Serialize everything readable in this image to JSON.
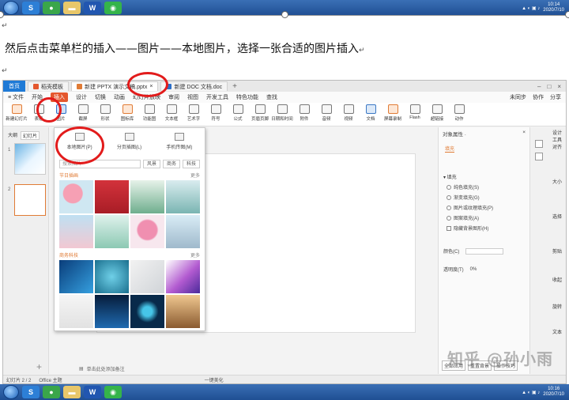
{
  "taskbar": {
    "time": "10:14",
    "date": "2020/7/10",
    "time_bottom": "10:16",
    "date_bottom": "2020/7/10",
    "apps": [
      "S",
      "W"
    ]
  },
  "document": {
    "instruction": "然后点击菜单栏的插入——图片——本地图片，选择一张合适的图片插入",
    "para_mark": "↵"
  },
  "wps": {
    "tabs": [
      {
        "label": "首页"
      },
      {
        "label": "稻壳模板"
      },
      {
        "label": "新建 PPTX 演示文稿.pptx"
      },
      {
        "label": "新建 DOC 文档.doc"
      }
    ],
    "menu": [
      "≡ 文件",
      "开始",
      "插入",
      "设计",
      "切换",
      "动画",
      "幻灯片放映",
      "审阅",
      "视图",
      "开发工具",
      "特色功能",
      "查找"
    ],
    "menu_right": [
      "未同步",
      "协作",
      "分享"
    ],
    "tools": [
      "新建幻灯片",
      "表格",
      "图片",
      "截屏",
      "形状",
      "图标库",
      "功能图",
      "文本框",
      "艺术字",
      "符号",
      "公式",
      "页眉页脚",
      "日期和时间",
      "附件",
      "音频",
      "视频",
      "文档",
      "屏幕录制",
      "Flash",
      "超链接",
      "动作"
    ],
    "left_panel": {
      "tab_outline": "大纲",
      "tab_slides": "幻灯片",
      "slide_nums": [
        "1",
        "2"
      ],
      "add": "+"
    },
    "picture_menu": {
      "options": [
        "本地图片(P)",
        "分页插图(L)",
        "手机传图(M)"
      ],
      "search_placeholder": "搜索图片",
      "chips": [
        "风景",
        "商务",
        "科技"
      ],
      "section1_title": "节日插画",
      "section2_title": "商务科技",
      "more": "更多"
    },
    "notes": "单击此处添加备注",
    "right_panel": {
      "title": "对象属性 ·",
      "tab": "填充",
      "section": "▾ 填充",
      "options": [
        "纯色填充(S)",
        "渐变填充(G)",
        "图片或纹理填充(P)",
        "图案填充(A)"
      ],
      "hide_bg": "隐藏背景图形(H)",
      "color_label": "颜色(C)",
      "transparency_label": "透明度(T)",
      "transparency_value": "0%",
      "buttons": [
        "全部应用",
        "重置背景",
        "操作技巧"
      ]
    },
    "sidebar": [
      "对齐",
      "大小",
      "选择",
      "剪贴",
      "收起",
      "旋转",
      "文本",
      "设计工具"
    ],
    "status": {
      "slide": "幻灯片 2 / 2",
      "theme": "Office 主题",
      "beautify": "一键美化"
    }
  },
  "watermark": "知乎 @孙小雨",
  "colors": {
    "annotation": "#e21b1b",
    "accent": "#e07b35",
    "taskbar": "#2a5da6"
  }
}
